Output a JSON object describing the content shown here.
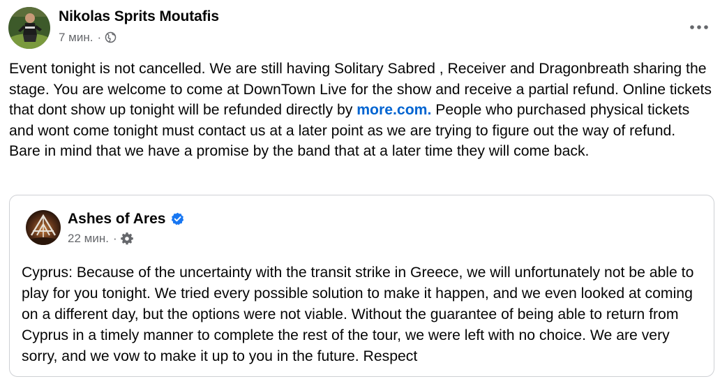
{
  "post": {
    "author": "Nikolas Sprits Moutafis",
    "time": "7 мин.",
    "separator": "·",
    "privacy_icon": "globe-icon",
    "menu_icon": "more-options-icon",
    "body": {
      "p1_before": "Event tonight is not cancelled. We are still having Solitary Sabred , Receiver and Dragonbreath sharing the stage. You are welcome to come at DownTown Live for the show and receive a partial refund. Online tickets that dont show up tonight will be refunded directly by ",
      "link": "more.com.",
      "p1_after": " People who purchased physical tickets and wont come tonight must contact us at a later point as we are trying to figure out the way of refund.",
      "p2": "Bare in mind that we have a promise by the band that at a later time they will come back."
    }
  },
  "shared_post": {
    "author": "Ashes of Ares",
    "verified_icon": "verified-badge-icon",
    "time": "22 мин.",
    "separator": "·",
    "audience_icon": "gear-icon",
    "text": "Cyprus: Because of the uncertainty with the transit strike in Greece, we will unfortunately not be able to play for you tonight. We tried every possible solution to make it happen, and we even looked at coming on a different day, but the options were not viable. Without the guarantee of being able to return from Cyprus in a timely manner to complete the rest of the tour, we were left with no choice. We are very sorry, and we vow to make it up to you in the future. Respect"
  },
  "colors": {
    "text": "#050505",
    "secondary_text": "#65676b",
    "link": "#0064d1",
    "verified": "#1877f2",
    "border": "#ced0d4"
  }
}
